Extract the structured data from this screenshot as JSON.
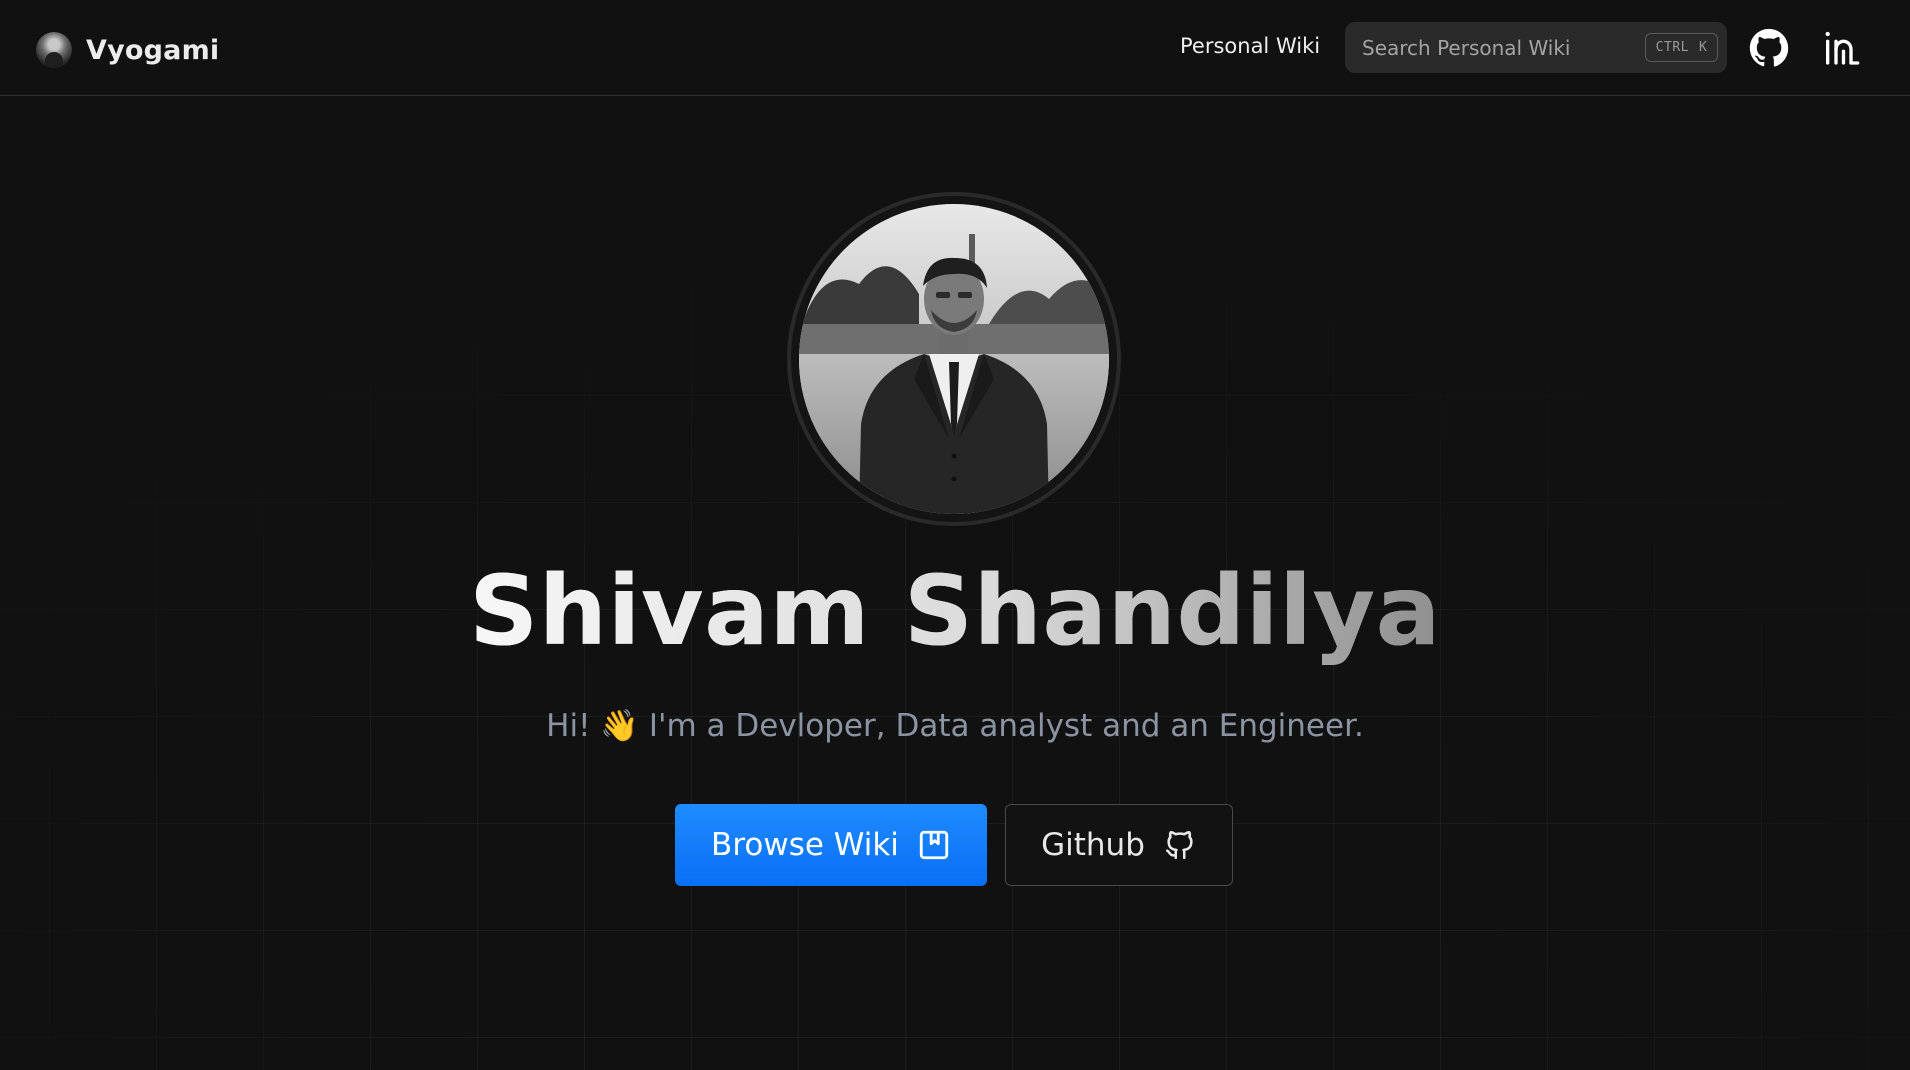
{
  "brand": {
    "title": "Vyogami",
    "logo_icon": "avatar-logo-icon"
  },
  "nav": {
    "links": [
      {
        "label": "Personal Wiki"
      }
    ],
    "search": {
      "placeholder": "Search Personal Wiki",
      "shortcut_ctrl": "CTRL",
      "shortcut_key": "K"
    },
    "icons": {
      "github": "github-icon",
      "linkedin": "linkedin-icon"
    }
  },
  "hero": {
    "name": "Shivam Shandilya",
    "subtitle": "Hi! 👋 I'm a Devloper, Data analyst and an Engineer.",
    "primary_button": {
      "label": "Browse Wiki",
      "icon": "book-icon"
    },
    "secondary_button": {
      "label": "Github",
      "icon": "github-outline-icon"
    }
  },
  "colors": {
    "background": "#111111",
    "accent": "#0a6ff5",
    "subtitle_text": "#8a94a3"
  }
}
